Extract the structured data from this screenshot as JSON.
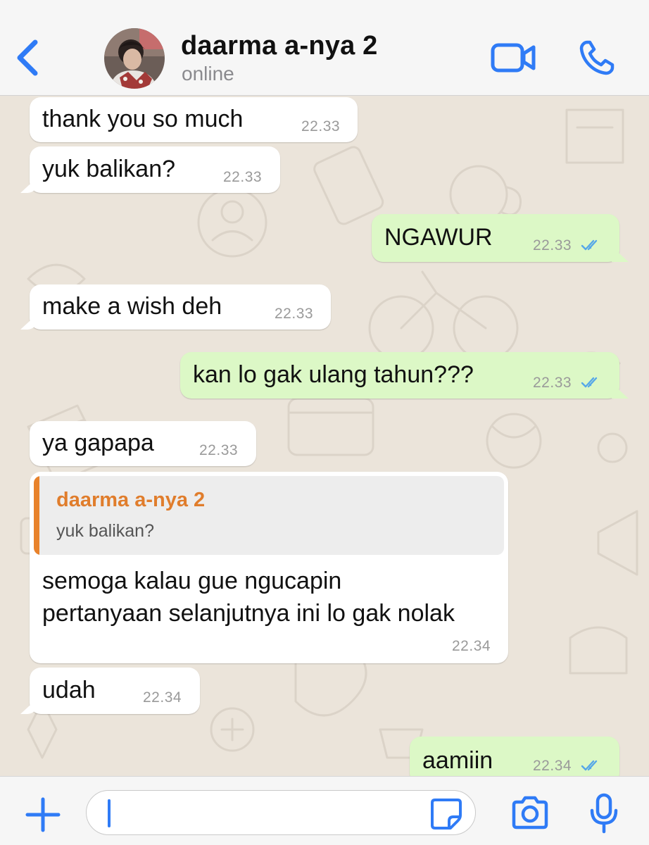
{
  "header": {
    "back_icon": "chevron-left-icon",
    "contact_name": "daarma a-nya 2",
    "status": "online",
    "video_icon": "video-camera-icon",
    "call_icon": "phone-icon"
  },
  "colors": {
    "accent": "#2f7bf6",
    "incoming_bubble": "#ffffff",
    "outgoing_bubble": "#dcf8c6",
    "chat_background": "#ebe4da",
    "quote_author": "#e07d2c",
    "read_ticks": "#55a7e8"
  },
  "messages": [
    {
      "direction": "in",
      "text": "thank you so much",
      "time": "22.33"
    },
    {
      "direction": "in",
      "text": "yuk balikan?",
      "time": "22.33"
    },
    {
      "direction": "out",
      "text": "NGAWUR",
      "time": "22.33",
      "status": "read"
    },
    {
      "direction": "in",
      "text": "make a wish deh",
      "time": "22.33"
    },
    {
      "direction": "out",
      "text": "kan lo gak ulang tahun???",
      "time": "22.33",
      "status": "read"
    },
    {
      "direction": "in",
      "text": "ya gapapa",
      "time": "22.33"
    },
    {
      "direction": "in",
      "quote": {
        "author": "daarma a-nya 2",
        "text": "yuk balikan?"
      },
      "lines": [
        "semoga kalau gue ngucapin",
        "pertanyaan selanjutnya ini lo gak nolak"
      ],
      "time": "22.34"
    },
    {
      "direction": "in",
      "text": "udah",
      "time": "22.34"
    },
    {
      "direction": "out",
      "text": "aamiin",
      "time": "22.34",
      "status": "read"
    }
  ],
  "input_bar": {
    "plus_icon": "plus-icon",
    "message_value": "",
    "sticker_icon": "sticker-icon",
    "camera_icon": "camera-icon",
    "mic_icon": "microphone-icon"
  }
}
